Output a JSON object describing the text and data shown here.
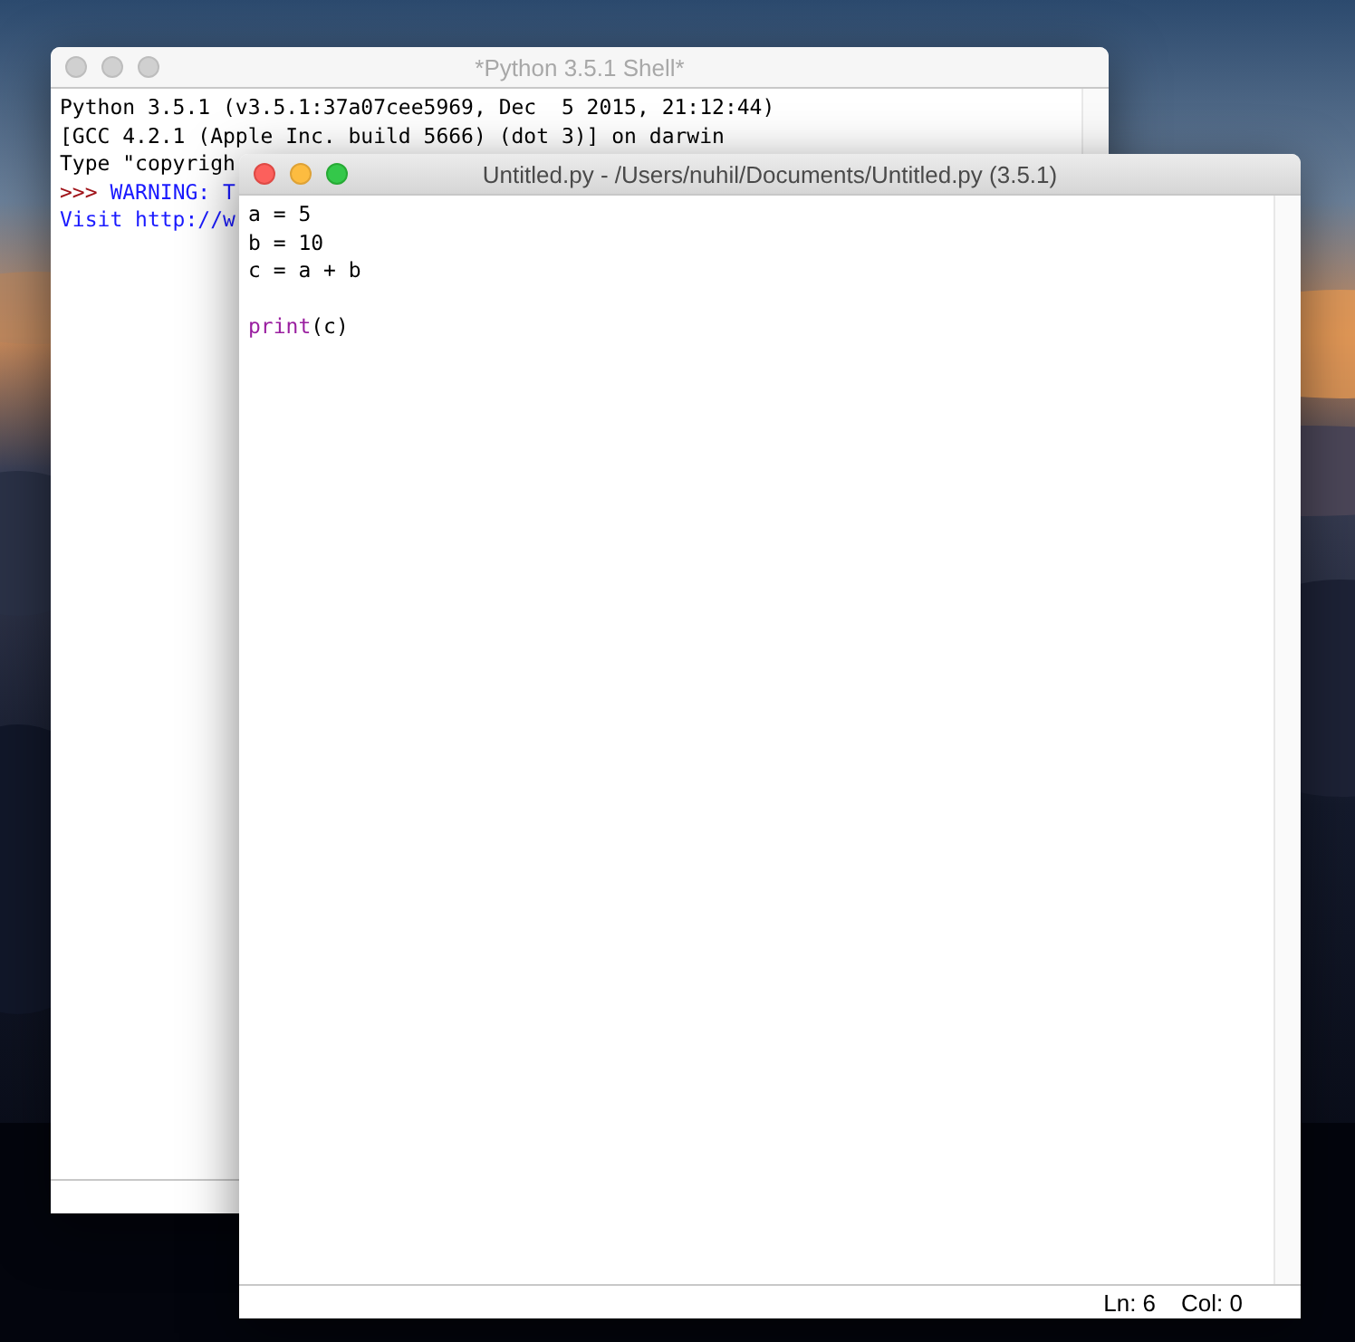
{
  "windows": [
    {
      "kind": "shell",
      "title": "*Python 3.5.1 Shell*",
      "active": false,
      "lines": [
        {
          "segments": [
            {
              "text": "Python 3.5.1 (v3.5.1:37a07cee5969, Dec  5 2015, 21:12:44)",
              "kind": "output"
            }
          ]
        },
        {
          "segments": [
            {
              "text": "[GCC 4.2.1 (Apple Inc. build 5666) (dot 3)] on darwin",
              "kind": "output"
            }
          ]
        },
        {
          "segments": [
            {
              "text": "Type \"copyrigh",
              "kind": "output"
            }
          ]
        },
        {
          "segments": [
            {
              "text": ">>> ",
              "kind": "prompt"
            },
            {
              "text": "WARNING: T",
              "kind": "warning"
            }
          ]
        },
        {
          "segments": [
            {
              "text": "Visit http://w",
              "kind": "warning"
            }
          ]
        }
      ]
    },
    {
      "kind": "editor",
      "title": "Untitled.py - /Users/nuhil/Documents/Untitled.py (3.5.1)",
      "active": true,
      "lines": [
        {
          "segments": [
            {
              "text": "a = 5",
              "kind": "plain"
            }
          ]
        },
        {
          "segments": [
            {
              "text": "b = 10",
              "kind": "plain"
            }
          ]
        },
        {
          "segments": [
            {
              "text": "c = a + b",
              "kind": "plain"
            }
          ]
        },
        {
          "spaced": true,
          "segments": [
            {
              "text": "print",
              "kind": "builtin"
            },
            {
              "text": "(c)",
              "kind": "plain"
            }
          ]
        }
      ],
      "status": {
        "line": "Ln: 6",
        "column": "Col: 0"
      }
    }
  ]
}
